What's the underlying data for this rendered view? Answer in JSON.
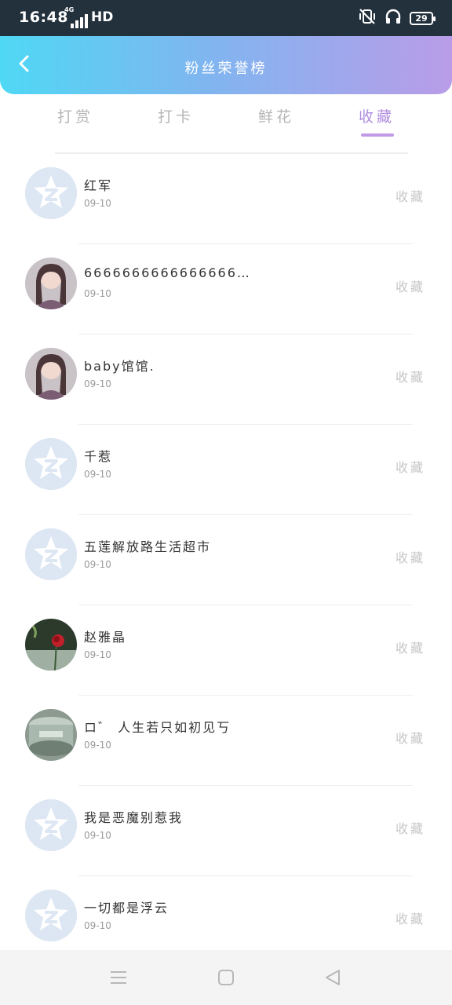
{
  "status_bar": {
    "time": "16:48",
    "network": "4G",
    "hd": "HD",
    "battery": "29"
  },
  "header": {
    "title": "粉丝荣誉榜",
    "back_icon": "chevron-left-icon"
  },
  "tabs": [
    {
      "label": "打赏",
      "active": false
    },
    {
      "label": "打卡",
      "active": false
    },
    {
      "label": "鲜花",
      "active": false
    },
    {
      "label": "收藏",
      "active": true
    }
  ],
  "list": [
    {
      "name": "红军",
      "date": "09-10",
      "action": "收藏",
      "avatar": "default-avatar-icon"
    },
    {
      "name": "6666666666666666666666666...",
      "date": "09-10",
      "action": "收藏",
      "avatar": "user-photo"
    },
    {
      "name": "baby馆馆.",
      "date": "09-10",
      "action": "收藏",
      "avatar": "user-photo"
    },
    {
      "name": "千惹",
      "date": "09-10",
      "action": "收藏",
      "avatar": "default-avatar-icon"
    },
    {
      "name": "五莲解放路生活超市",
      "date": "09-10",
      "action": "收藏",
      "avatar": "default-avatar-icon"
    },
    {
      "name": "赵雅晶",
      "date": "09-10",
      "action": "收藏",
      "avatar": "rose-photo"
    },
    {
      "name": "ロ゛ 人生若只如初见丂",
      "date": "09-10",
      "action": "收藏",
      "avatar": "glass-photo"
    },
    {
      "name": "我是恶魔别惹我",
      "date": "09-10",
      "action": "收藏",
      "avatar": "default-avatar-icon"
    },
    {
      "name": "一切都是浮云",
      "date": "09-10",
      "action": "收藏",
      "avatar": "default-avatar-icon"
    }
  ],
  "nav_bar": {
    "menu_icon": "menu-icon",
    "home_icon": "square-home-icon",
    "back_icon": "triangle-back-icon"
  },
  "colors": {
    "header_gradient_start": "#4fd8f4",
    "header_gradient_end": "#b99ce8",
    "active_tab": "#b08ee0",
    "inactive_tab": "#b5b5b5"
  }
}
